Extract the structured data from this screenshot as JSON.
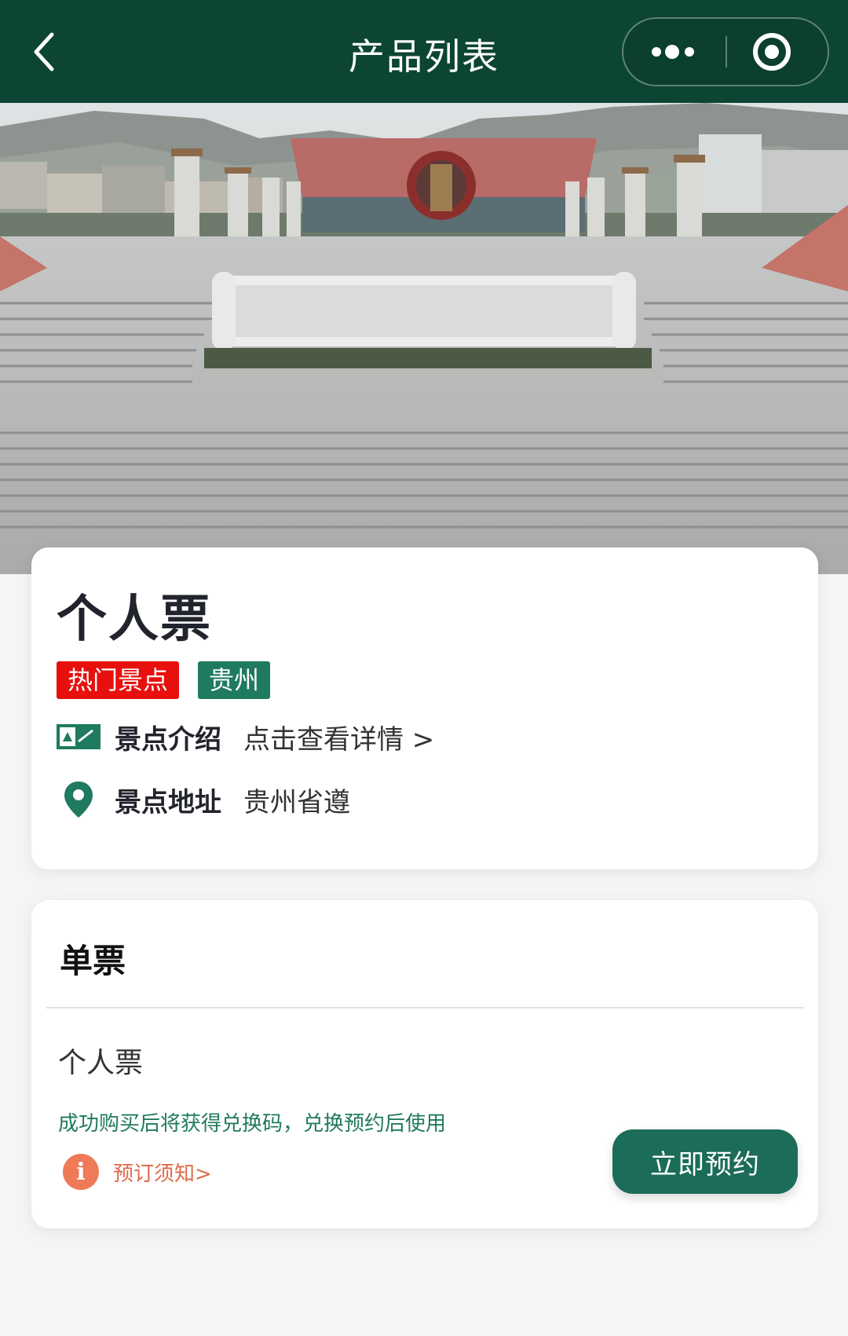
{
  "header": {
    "title": "产品列表",
    "back_icon": "chevron-left-icon",
    "more_icon": "more-dots-icon",
    "close_icon": "target-circle-icon",
    "background_color": "#0c4534"
  },
  "hero": {
    "image": "memorial-plaza-photo"
  },
  "attraction": {
    "title": "个人票",
    "tags": [
      {
        "label": "热门景点",
        "color": "#e8100e"
      },
      {
        "label": "贵州",
        "color": "#1f7a5f"
      }
    ],
    "rows": [
      {
        "icon": "map-guide-icon",
        "label": "景点介绍",
        "value": "点击查看详情 >"
      },
      {
        "icon": "location-pin-icon",
        "label": "景点地址",
        "value": "贵州省遵"
      }
    ]
  },
  "ticket_section": {
    "title": "单票",
    "product": {
      "name": "个人票",
      "note": "成功购买后将获得兑换码，兑换预约后使用",
      "notice_label": "预订须知>",
      "notice_icon": "info-icon",
      "button_label": "立即预约",
      "button_color": "#1b6c59"
    }
  }
}
